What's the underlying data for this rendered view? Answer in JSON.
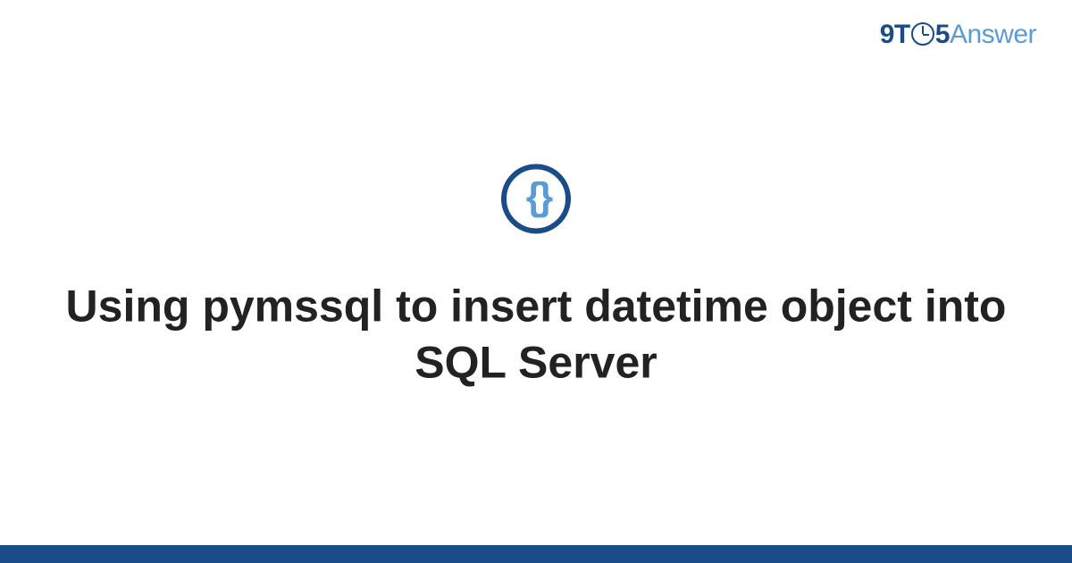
{
  "logo": {
    "part1": "9T",
    "part2": "5",
    "part3": "Answer"
  },
  "icon": {
    "glyph": "{ }",
    "name": "code-braces"
  },
  "title": "Using pymssql to insert datetime object into SQL Server",
  "colors": {
    "primary": "#1a4c8a",
    "accent": "#5a9dd6",
    "text": "#222222"
  }
}
